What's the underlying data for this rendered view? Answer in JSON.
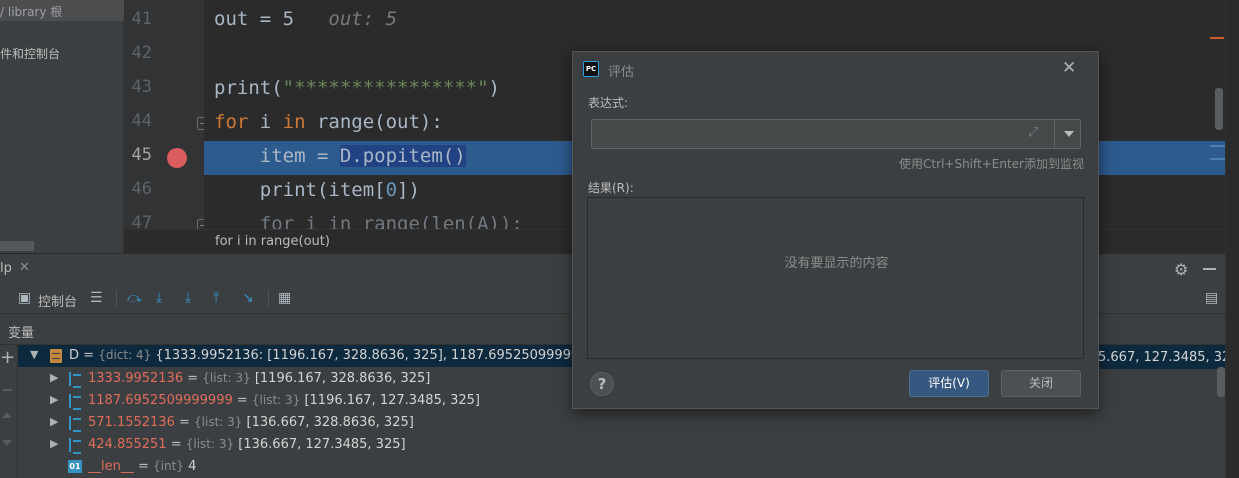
{
  "project_panel": {
    "header_text": "/ library 根",
    "ext_libs_text": "件和控制台"
  },
  "editor": {
    "line_numbers": [
      "41",
      "42",
      "43",
      "44",
      "45",
      "46",
      "47"
    ],
    "lines": {
      "l41_code": "out = 5",
      "l41_inline": "out: 5",
      "l43_fn": "print(",
      "l43_str": "\"****************\"",
      "l43_close": ")",
      "l44_kw": "for",
      "l44_var": " i ",
      "l44_in": "in",
      "l44_rest": " range(out):",
      "l45_pre": "    item = ",
      "l45_call": "D.popitem()",
      "l46_pre": "    print(item[",
      "l46_num": "0",
      "l46_post": "])",
      "l47_text": "    for i in range(len(A)):"
    },
    "breadcrumb": "for i in range(out)"
  },
  "debug": {
    "tab_label": "lp",
    "console_label": "控制台",
    "variables_header": "变量",
    "variables": [
      {
        "name": "D",
        "type": "{dict: 4}",
        "value": "{1333.9952136: [1196.167, 328.8636, 325], 1187.6952509999999: [",
        "icon": "dict-icon",
        "expanded": true
      },
      {
        "name": "1333.9952136",
        "type": "{list: 3}",
        "value": "[1196.167, 328.8636, 325]",
        "icon": "list-icon"
      },
      {
        "name": "1187.6952509999999",
        "type": "{list: 3}",
        "value": "[1196.167, 127.3485, 325]",
        "icon": "list-icon"
      },
      {
        "name": "571.1552136",
        "type": "{list: 3}",
        "value": "[136.667, 328.8636, 325]",
        "icon": "list-icon"
      },
      {
        "name": "424.855251",
        "type": "{list: 3}",
        "value": "[136.667, 127.3485, 325]",
        "icon": "list-icon"
      },
      {
        "name": "__len__",
        "type": "{int}",
        "value": "4",
        "icon": "int-icon"
      }
    ],
    "row_tail": "5.667, 127.3485, 325]"
  },
  "dialog": {
    "title": "评估",
    "expression_label": "表达式:",
    "expression_value": "",
    "hint": "使用Ctrl+Shift+Enter添加到监视",
    "result_label": "结果(R):",
    "empty_text": "没有要显示的内容",
    "evaluate_button": "评估(V)",
    "close_button": "关闭",
    "help_glyph": "?"
  },
  "icon_badges": {
    "app_icon": "PC",
    "int_icon": "01"
  },
  "colors": {
    "exec_line": "#2d5b8e",
    "breakpoint": "#db5c5c",
    "primary_button": "#365880"
  }
}
